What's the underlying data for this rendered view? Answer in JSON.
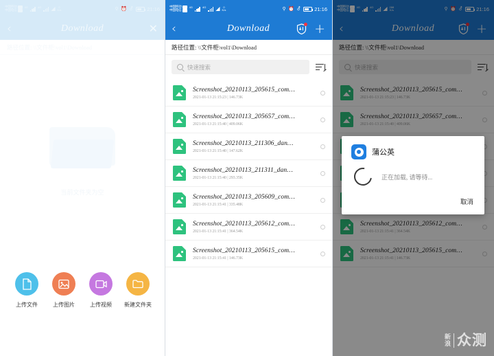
{
  "statusbar": {
    "carrier_line1": "中国移动",
    "carrier_line2": "中国电信",
    "sim1_label": "4G",
    "sim2_label": "4G",
    "netspeed_value": "0",
    "netspeed_unit": "K/s",
    "netspeed_value_right": "288",
    "clock": "21:16",
    "icons": [
      "key-icon",
      "alarm-icon",
      "bluetooth-icon",
      "battery-icon"
    ]
  },
  "appbar": {
    "title": "Download",
    "back_icon": "chevron-left-icon",
    "close_icon": "close-icon",
    "download_icon": "shield-download-icon",
    "add_icon": "plus-icon",
    "badge": true
  },
  "pathbar": {
    "label": "路径位置:",
    "value": "\\\\文件柜\\vol1\\Download",
    "full": "路径位置:  \\\\文件柜\\vol1\\Download"
  },
  "search": {
    "placeholder": "快速搜索",
    "icon": "search-icon",
    "sort_icon": "sort-descending-icon"
  },
  "left_panel": {
    "empty_text": "当前文件夹为空",
    "quick_actions": [
      {
        "label": "上传文件",
        "color": "#4ec0ea",
        "icon": "document-icon"
      },
      {
        "label": "上传图片",
        "color": "#ef7f54",
        "icon": "image-icon"
      },
      {
        "label": "上传视频",
        "color": "#c578e0",
        "icon": "video-icon"
      },
      {
        "label": "新建文件夹",
        "color": "#f5b544",
        "icon": "folder-icon"
      }
    ]
  },
  "files": [
    {
      "name": "Screenshot_20210113_205615_com",
      "ellipsis": "…",
      "date": "2021-01-13 21:15:23",
      "size": "146.73K"
    },
    {
      "name": "Screenshot_20210113_205657_com",
      "ellipsis": "…",
      "date": "2021-01-13 21:15:40",
      "size": "409.06K"
    },
    {
      "name": "Screenshot_20210113_211306_dan",
      "ellipsis": "…",
      "date": "2021-01-13 21:15:40",
      "size": "147.62K"
    },
    {
      "name": "Screenshot_20210113_211311_dan",
      "ellipsis": "…",
      "date": "2021-01-13 21:15:40",
      "size": "293.35K"
    },
    {
      "name": "Screenshot_20210113_205609_com",
      "ellipsis": "…",
      "date": "2021-01-13 21:15:41",
      "size": "335.48K"
    },
    {
      "name": "Screenshot_20210113_205612_com",
      "ellipsis": "…",
      "date": "2021-01-13 21:15:41",
      "size": "364.54K"
    },
    {
      "name": "Screenshot_20210113_205615_com",
      "ellipsis": "…",
      "date": "2021-01-13 21:15:41",
      "size": "146.73K"
    }
  ],
  "dialog": {
    "app_name": "蒲公英",
    "app_icon": "pgyer-logo-icon",
    "message": "正在加载, 请等待...",
    "cancel_label": "取消",
    "spinner_icon": "loading-spinner-icon"
  },
  "watermark": {
    "line1": "新",
    "line2": "浪",
    "big": "众测"
  },
  "colors": {
    "appbar_blue": "#1e7bd4",
    "appbar_pale": "#d6eaf8",
    "file_icon_green": "#2ec27e",
    "badge_red": "#f5333f"
  }
}
